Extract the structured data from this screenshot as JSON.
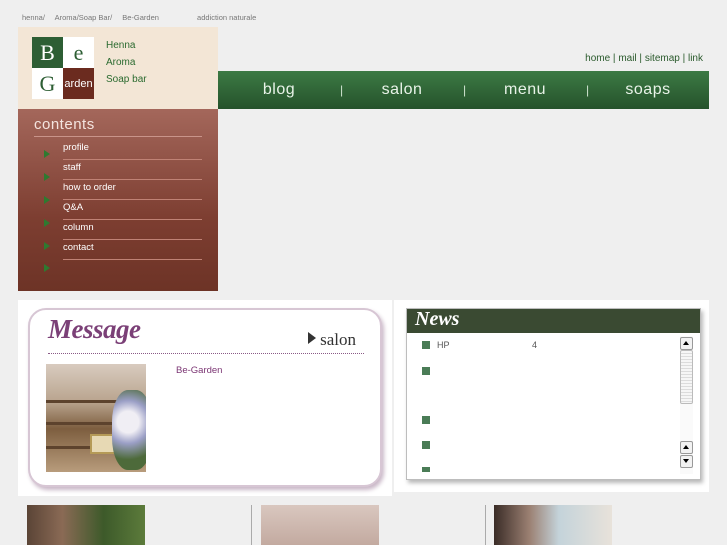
{
  "tagline": {
    "items": [
      "henna/",
      "Aroma/Soap Bar/",
      "Be-Garden"
    ],
    "tail": "addiction naturale"
  },
  "logo": {
    "cells": [
      "B",
      "e",
      "G",
      "arden"
    ],
    "lines": [
      "Henna",
      "Aroma",
      "Soap bar"
    ]
  },
  "toplinks": [
    "home",
    "mail",
    "sitemap",
    "link"
  ],
  "nav": [
    "blog",
    "salon",
    "menu",
    "soaps"
  ],
  "contents": {
    "title": "contents",
    "items": [
      "profile",
      "staff",
      "how to order",
      "Q&A",
      "column",
      "contact"
    ]
  },
  "message": {
    "title": "Message",
    "salon_link": "salon",
    "text": "Be-Garden"
  },
  "news": {
    "title": "News",
    "items": [
      {
        "text": "HP",
        "num": "4"
      },
      {
        "text": "",
        "num": ""
      },
      {
        "text": "",
        "num": ""
      },
      {
        "text": "",
        "num": ""
      },
      {
        "text": "",
        "num": ""
      }
    ]
  },
  "colors": {
    "nav_green": "#2f6a37",
    "sidebar_brown": "#7d3e31",
    "message_purple": "#7b4077",
    "news_header": "#3a4a32"
  }
}
